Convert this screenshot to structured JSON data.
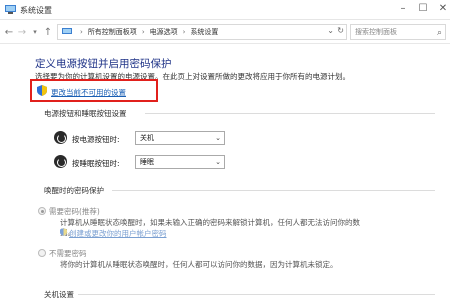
{
  "window": {
    "title": "系统设置"
  },
  "addressbar": {
    "crumbs": [
      "所有控制面板项",
      "电源选项",
      "系统设置"
    ],
    "search_placeholder": "搜索控制面板"
  },
  "main": {
    "title": "定义电源按钮并启用密码保护",
    "intro": "选择要为你的计算机设置的电源设置。在此页上对设置所做的更改将应用于你所有的电源计划。",
    "change_link": "更改当前不可用的设置"
  },
  "buttons_section": {
    "heading": "电源按钮和睡眠按钮设置",
    "rows": [
      {
        "label": "按电源按钮时:",
        "value": "关机"
      },
      {
        "label": "按睡眠按钮时:",
        "value": "睡眠"
      }
    ]
  },
  "wake_section": {
    "heading": "唤醒时的密码保护",
    "options": [
      {
        "label": "需要密码(推荐)",
        "selected": true,
        "desc_lines": [
          "计算机从睡眠状态唤醒时，如果未输入正确的密码来解锁计算机，任何人都无法访问你的数",
          "据。"
        ],
        "link": "创建或更改你的用户帐户密码"
      },
      {
        "label": "不需要密码",
        "selected": false,
        "desc_lines": [
          "将你的计算机从睡眠状态唤醒时，任何人都可以访问你的数据，因为计算机未锁定。"
        ]
      }
    ]
  },
  "shutdown_section": {
    "heading": "关机设置"
  },
  "colors": {
    "title_blue": "#1e3287",
    "link_blue": "#1a5fb4",
    "highlight_red": "#e1201c"
  }
}
